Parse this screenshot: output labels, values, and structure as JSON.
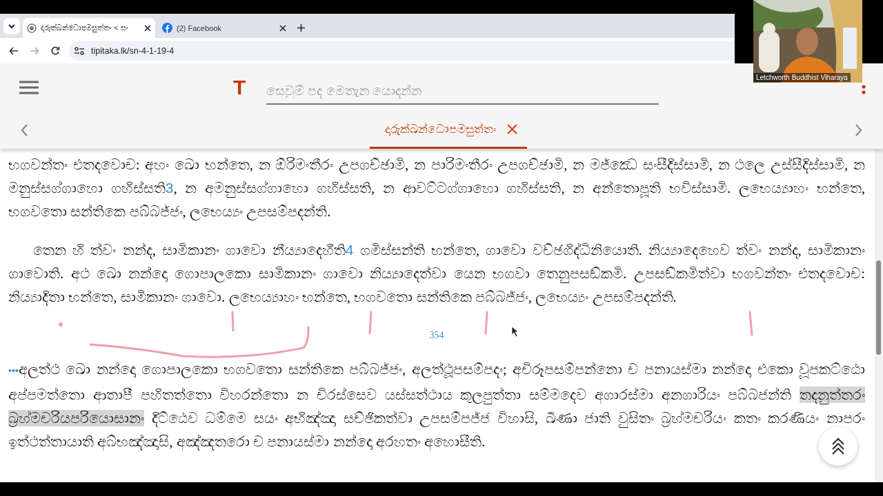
{
  "browser": {
    "tabs": [
      {
        "title": "දාරුක්ඛන්ධොපමසුත්තං < සං",
        "kind": "site",
        "selected": true
      },
      {
        "title": "(2) Facebook",
        "kind": "social",
        "selected": false
      }
    ],
    "address": "tipitaka.lk/sn-4-1-19-4"
  },
  "header": {
    "logo": "T",
    "search": {
      "placeholder": "සෙවුම් පද මෙතැන යොදන්න"
    },
    "open_tab": {
      "title": "දාරුක්ඛන්ධොපමසුත්තං"
    }
  },
  "paragraphs": [
    {
      "indent": false,
      "parts": [
        {
          "kind": "text",
          "text": "භගවන්තං එතදවොච: අහං ඛො භන්තෙ, න ඕරිමංතීරං උපගච්ඡාමි, න පාරිමංතීරං උපගච්ඡාමි, න මජ්ඣෙ සංසීදිස්සාමි, න ථලෙ උස්සීදිස්සාමි, න මනුස්සග්ගාහො ගහිස්සති"
        },
        {
          "kind": "note",
          "text": "3"
        },
        {
          "kind": "text",
          "text": ", න අමනුස්සග්ගාහො ගහිස්සති, න ආවට්ටග්ගාහො ගහිස්සති, න අන්තොපූති භවිස්සාමි. ලභෙය්‍යාහං භන්තෙ, භගවතො සන්තිකෙ පබ්බජ්ජං, ලභෙය්‍යං උපසම්පදන්ති."
        }
      ]
    },
    {
      "indent": true,
      "parts": [
        {
          "kind": "text",
          "text": "තෙන හි ත්වං නන්ද, සාමිකානං ගාවො නීය්‍යාදෙහීති"
        },
        {
          "kind": "note",
          "text": "4"
        },
        {
          "kind": "text",
          "text": " ගමිස්සන්ති භන්තෙ, ගාවො වච්ඡගිද්ධිනියොති. නිය්‍යාදෙහෙව ත්වං නන්ද, සාමිකානං ගාවොති. අථ ඛො නන්දො ගොපාලකො සාමිකානං ගාවො නිය්‍යාදෙත්වා යෙන භගවා තෙනුපසඞ්කමි. උපසඞ්කමිත්වා භගවන්තං එතදවොච: නිය්‍යාදිතා භන්තෙ, සාමිකානං ගාවො. ලභෙය්‍යාහං භන්තෙ, භගවතො සන්තිකෙ පබ්බජ්ජං, ලභෙය්‍යං උපසම්පදන්ති."
        }
      ]
    },
    {
      "kind": "page",
      "text": "354"
    },
    {
      "indent": false,
      "parts": [
        {
          "kind": "lead",
          "text": "•••"
        },
        {
          "kind": "text",
          "text": "අලත්ථ ඛො නන්දො ගොපාලකො භගවතො සන්තිකෙ පබ්බජ්ජං, අලත්ථූපසම්පදං; අචිරූපසම්පන්නො ච පනායස්මා නන්දො එකො වූපකට්ඨො අප්පමත්තො ආතාපී පහිතත්තො විහරන්තො න චිරස්සෙව යස්සත්ථාය කුලපුත්තා සම්මදෙව අගාරස්මා අනගාරියං පබ්බජන්ති "
        },
        {
          "kind": "mark",
          "text": "තදනුත්තරං බ්‍රහ්මචරියපරියොසානං"
        },
        {
          "kind": "text",
          "text": " දිට්ඨෙව ධම්මෙ සයං අභිඤ්ඤා සච්ඡිකත්වා උපසම්පජ්ජ විහාසි, ඛීණා ජාති වුසිතං බ්‍රහ්මචරියං කතං කරණීයං නාපරං ඉත්ථත්තායාති අබ්භඤ්ඤාසි, අඤ්ඤතරො ච පනායස්මා නන්දො අරහතං අහොසීති."
        }
      ]
    }
  ],
  "video": {
    "name": "Letchworth Buddhist Viharaya"
  }
}
